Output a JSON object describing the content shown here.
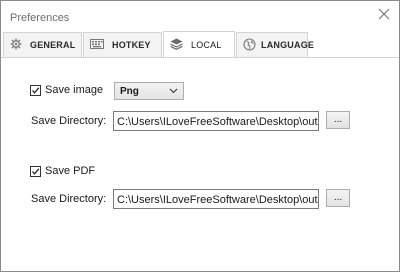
{
  "window": {
    "title": "Preferences"
  },
  "tabs": [
    {
      "label": "GENERAL",
      "icon": "gear-icon",
      "active": false
    },
    {
      "label": "HOTKEY",
      "icon": "keyboard-icon",
      "active": false
    },
    {
      "label": "LOCAL",
      "icon": "stack-icon",
      "active": true
    },
    {
      "label": "LANGUAGE",
      "icon": "globe-icon",
      "active": false
    }
  ],
  "local": {
    "save_image": {
      "label": "Save image",
      "checked": true,
      "format_selected": "Png",
      "directory_label": "Save Directory:",
      "directory_value": "C:\\Users\\ILoveFreeSoftware\\Desktop\\output",
      "browse_label": "..."
    },
    "save_pdf": {
      "label": "Save PDF",
      "checked": true,
      "directory_label": "Save Directory:",
      "directory_value": "C:\\Users\\ILoveFreeSoftware\\Desktop\\output",
      "browse_label": "..."
    }
  }
}
